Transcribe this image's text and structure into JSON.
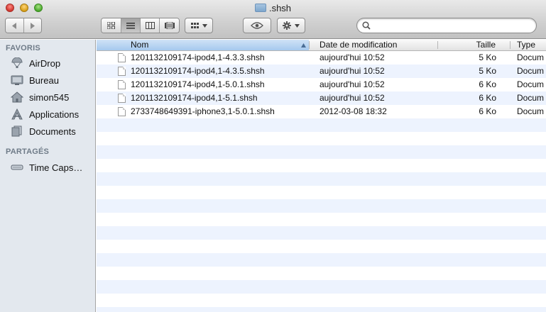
{
  "window": {
    "title": ".shsh"
  },
  "toolbar": {
    "back_icon": "chevron-left",
    "forward_icon": "chevron-right",
    "view_modes": [
      "icon-view",
      "list-view",
      "column-view",
      "coverflow-view"
    ],
    "active_view": "list-view",
    "arrange_icon": "grid",
    "quicklook_icon": "eye",
    "action_icon": "gear",
    "search": {
      "value": "",
      "placeholder": ""
    }
  },
  "sidebar": {
    "favorites_title": "FAVORIS",
    "favorites": [
      {
        "label": "AirDrop",
        "icon": "airdrop"
      },
      {
        "label": "Bureau",
        "icon": "desktop"
      },
      {
        "label": "simon545",
        "icon": "home"
      },
      {
        "label": "Applications",
        "icon": "applications"
      },
      {
        "label": "Documents",
        "icon": "documents"
      }
    ],
    "shared_title": "PARTAGÉS",
    "shared": [
      {
        "label": "Time Caps…",
        "icon": "time-capsule"
      }
    ]
  },
  "list": {
    "columns": {
      "name": "Nom",
      "date": "Date de modification",
      "size": "Taille",
      "type": "Type"
    },
    "sorted_column": "Nom",
    "rows": [
      {
        "name": "1201132109174-ipod4,1-4.3.3.shsh",
        "date": "aujourd'hui 10:52",
        "size": "5 Ko",
        "type": "Docum"
      },
      {
        "name": "1201132109174-ipod4,1-4.3.5.shsh",
        "date": "aujourd'hui 10:52",
        "size": "5 Ko",
        "type": "Docum"
      },
      {
        "name": "1201132109174-ipod4,1-5.0.1.shsh",
        "date": "aujourd'hui 10:52",
        "size": "6 Ko",
        "type": "Docum"
      },
      {
        "name": "1201132109174-ipod4,1-5.1.shsh",
        "date": "aujourd'hui 10:52",
        "size": "6 Ko",
        "type": "Docum"
      },
      {
        "name": "2733748649391-iphone3,1-5.0.1.shsh",
        "date": "2012-03-08 18:32",
        "size": "6 Ko",
        "type": "Docum"
      }
    ]
  },
  "colors": {
    "sidebar_bg": "#e3e8ee",
    "row_stripe": "#edf3fe",
    "sorted_header": "#a6c9ee"
  }
}
